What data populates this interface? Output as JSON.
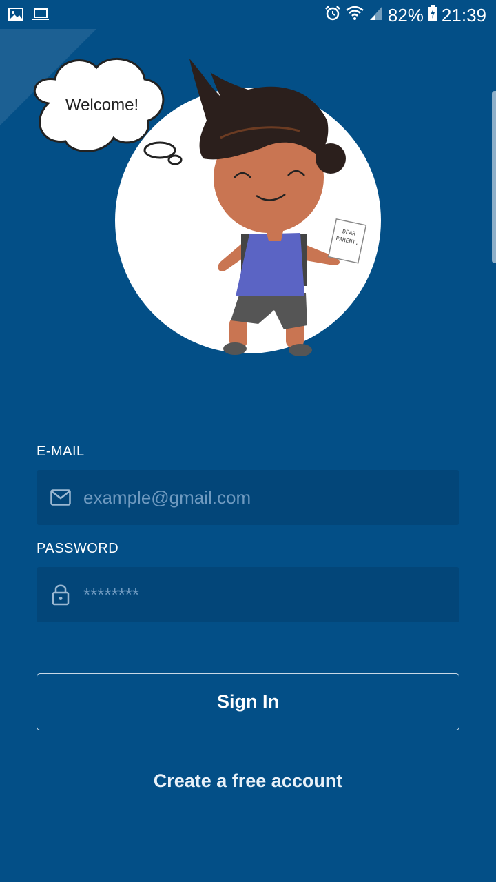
{
  "status_bar": {
    "battery": "82%",
    "time": "21:39",
    "left_icons": [
      "image-icon",
      "laptop-icon"
    ],
    "right_icons": [
      "alarm-icon",
      "wifi-icon",
      "signal-icon",
      "battery-charging-icon"
    ]
  },
  "hero": {
    "speech_bubble": "Welcome!",
    "note_text": "DEAR PARENT,"
  },
  "form": {
    "email_label": "E-MAIL",
    "email_placeholder": "example@gmail.com",
    "password_label": "PASSWORD",
    "password_placeholder": "********",
    "signin_label": "Sign In",
    "create_account_label": "Create a free account"
  },
  "colors": {
    "background": "#034f87",
    "field_background": "#034679",
    "placeholder": "#6f9ac0"
  }
}
